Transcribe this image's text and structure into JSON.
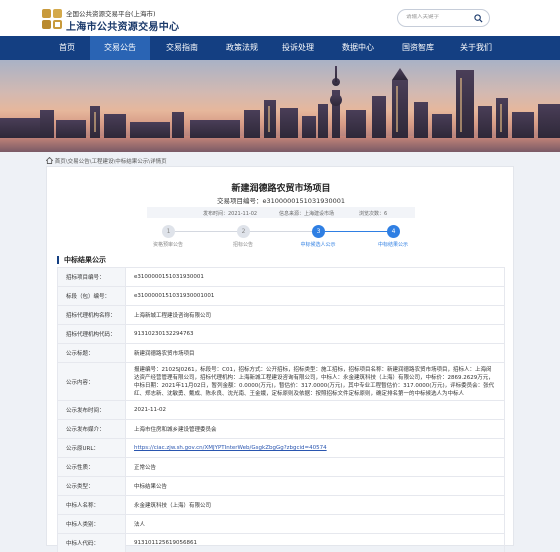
{
  "header": {
    "platform_small": "全国公共资源交易平台(上海市)",
    "platform_big": "上海市公共资源交易中心",
    "search_placeholder": "请输入关键字"
  },
  "nav": {
    "items": [
      {
        "label": "首页"
      },
      {
        "label": "交易公告",
        "active": true
      },
      {
        "label": "交易指南"
      },
      {
        "label": "政策法规"
      },
      {
        "label": "投诉处理"
      },
      {
        "label": "数据中心"
      },
      {
        "label": "国资智库"
      },
      {
        "label": "关于我们"
      }
    ]
  },
  "breadcrumb": {
    "text": "首页\\交易公告\\工程建设\\中标结果公示\\详情页"
  },
  "project": {
    "title": "新建润德路农贸市场项目",
    "code_line": "交易项目编号：e3100000151031930001",
    "publish_time": "发布时间：2021-11-02",
    "source": "信息来源：上海建设市场",
    "views": "浏览次数：6"
  },
  "steps": [
    {
      "num": "1",
      "label": "资格预审公告",
      "done": false
    },
    {
      "num": "2",
      "label": "招标公告",
      "done": false
    },
    {
      "num": "3",
      "label": "中标候选人公示",
      "done": true
    },
    {
      "num": "4",
      "label": "中标结果公示",
      "done": true
    }
  ],
  "section_title": "中标结果公示",
  "rows": [
    {
      "k": "招标项目编号：",
      "v": "e3100000151031930001"
    },
    {
      "k": "标段（包）编号：",
      "v": "e3100000151031930001001"
    },
    {
      "k": "招标代理机构名称：",
      "v": "上海新城工程建设咨询有限公司"
    },
    {
      "k": "招标代理机构代码：",
      "v": "91310230132294763"
    },
    {
      "k": "公示标题：",
      "v": "新建润德路农贸市场项目"
    },
    {
      "k": "公示内容：",
      "v": "报建编号：2102SJ0261，标段号：C01，招标方式：公开招标，招标类型：施工招标，招标项目名称：新建润德路农贸市场项目，招标人：上海闵达资产经营管理有限公司，招标代理机构：上海新城工程建设咨询有限公司，中标人：永金建筑科技（上海）有限公司，中标价：2869.2629万元，中标日期：2021年11月02日，暂列金额：0.0000(万元)，暂估价：317.0000(万元)，其中专业工程暂估价：317.0000(万元)，评标委员会：张代红、郑志新、沈敏勇、戴成、陈永良、沈光南、王金娥，定标原则及依据：按照招标文件定标原则，确定排名第一的中标候选人为中标人"
    },
    {
      "k": "公示发布时间：",
      "v": "2021-11-02"
    },
    {
      "k": "公示发布媒介：",
      "v": "上海市住房和城乡建设管理委员会"
    },
    {
      "k": "公示原URL：",
      "v": "https://ciac.zjw.sh.gov.cn/XMJYPTInterWeb/GsgkZbgGg?zbgcid=40574",
      "link": true
    },
    {
      "k": "公示性质：",
      "v": "正常公告"
    },
    {
      "k": "公示类型：",
      "v": "中标结果公告"
    },
    {
      "k": "中标人名称：",
      "v": "永金建筑科技（上海）有限公司"
    },
    {
      "k": "中标人类别：",
      "v": "法人"
    },
    {
      "k": "中标人代码：",
      "v": "913101125619056861"
    }
  ],
  "colors": {
    "nav_bg": "#143f82",
    "nav_active": "#2a64b4",
    "step_on": "#2f7fe3",
    "logo_gold": "#c89a3c"
  }
}
